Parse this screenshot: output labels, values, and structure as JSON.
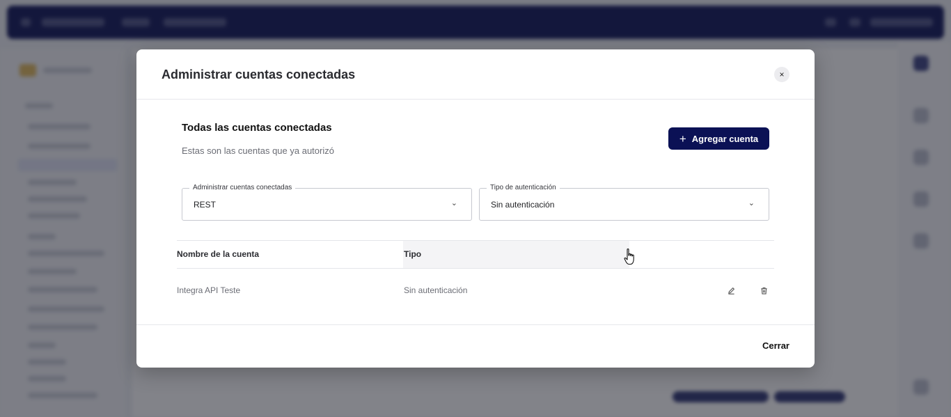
{
  "modal": {
    "title": "Administrar cuentas conectadas",
    "close_icon": "close-icon",
    "close_glyph": "×",
    "section": {
      "title": "Todas las cuentas conectadas",
      "subtitle": "Estas son las cuentas que ya autorizó"
    },
    "add_button": {
      "icon": "plus-icon",
      "glyph": "+",
      "label": "Agregar cuenta"
    },
    "filters": {
      "account_type": {
        "label": "Administrar cuentas conectadas",
        "value": "REST",
        "icon": "chevron-down-icon",
        "glyph": "⌄"
      },
      "auth_type": {
        "label": "Tipo de autenticación",
        "value": "Sin autenticación",
        "icon": "chevron-down-icon",
        "glyph": "⌄"
      }
    },
    "table": {
      "headers": {
        "name": "Nombre de la cuenta",
        "type": "Tipo"
      },
      "rows": [
        {
          "name": "Integra API Teste",
          "type": "Sin autenticación",
          "edit_icon": "pencil-icon",
          "delete_icon": "trash-icon"
        }
      ]
    },
    "footer": {
      "close_label": "Cerrar"
    }
  },
  "colors": {
    "primary": "#0b1155",
    "overlay": "rgba(28,30,40,0.55)",
    "border": "#c6c8cf",
    "header_highlight": "#f4f4f6"
  },
  "cursor": {
    "icon": "hand-pointer-icon"
  }
}
